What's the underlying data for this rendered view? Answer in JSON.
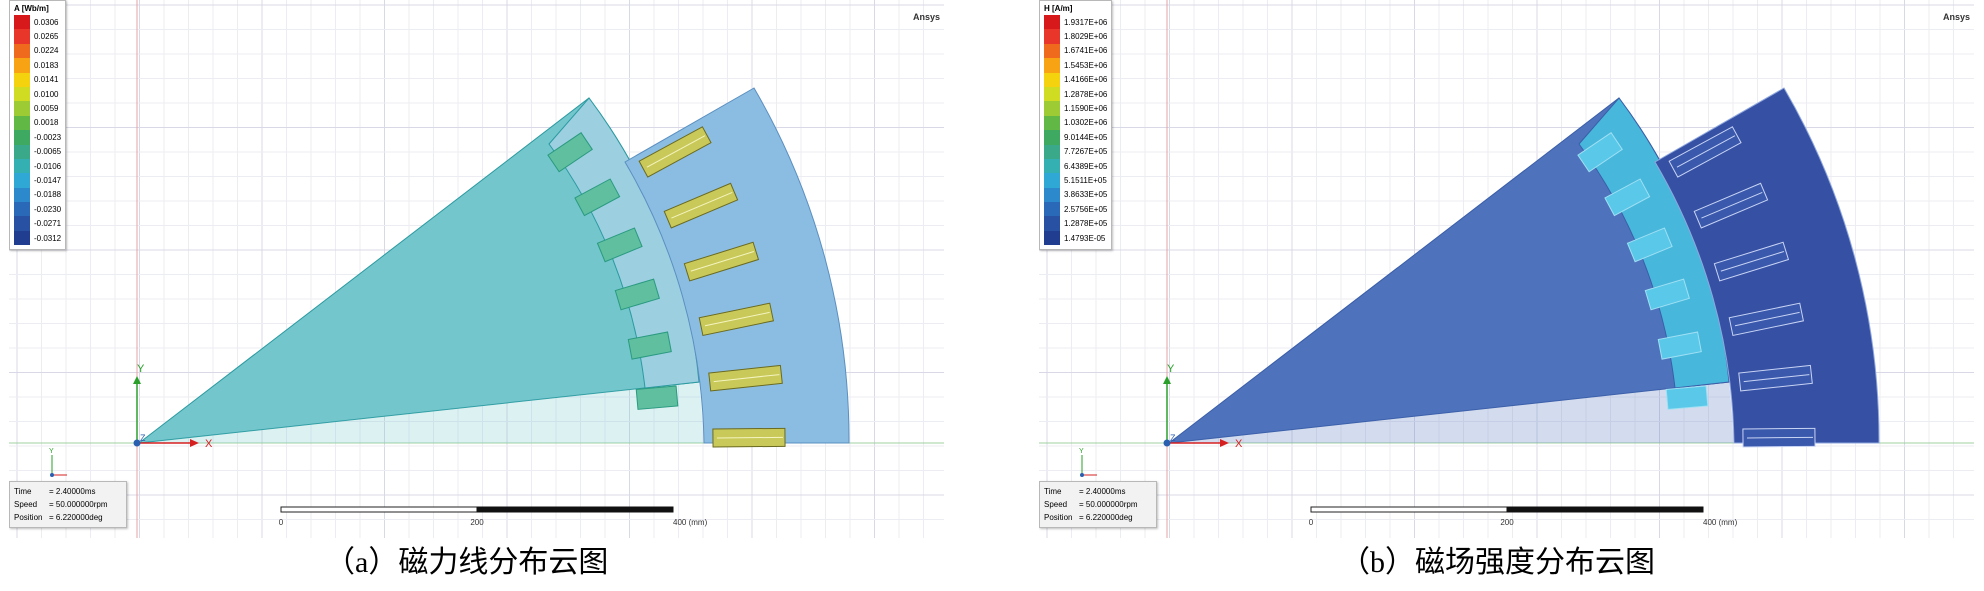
{
  "brand": "Ansys",
  "axes": {
    "y": "Y",
    "x": "X",
    "z": "Z"
  },
  "panels": [
    {
      "id": "a",
      "legend_title": "A [Wb/m]",
      "legend_values": [
        "0.0306",
        "0.0265",
        "0.0224",
        "0.0183",
        "0.0141",
        "0.0100",
        "0.0059",
        "0.0018",
        "-0.0023",
        "-0.0065",
        "-0.0106",
        "-0.0147",
        "-0.0188",
        "-0.0230",
        "-0.0271",
        "-0.0312"
      ],
      "caption": "（a）磁力线分布云图",
      "style": {
        "rotor": "#73c6cc",
        "rotor_edge": "#2a9aa0",
        "teeth": "#9ccfe0",
        "stator": "#8bbde3",
        "bars": "#c9c95a",
        "stator_edge": "#5a8fc0"
      }
    },
    {
      "id": "b",
      "legend_title": "H [A/m]",
      "legend_values": [
        "1.9317E+06",
        "1.8029E+06",
        "1.6741E+06",
        "1.5453E+06",
        "1.4166E+06",
        "1.2878E+06",
        "1.1590E+06",
        "1.0302E+06",
        "9.0144E+05",
        "7.7267E+05",
        "6.4389E+05",
        "5.1511E+05",
        "3.8633E+05",
        "2.5756E+05",
        "1.2878E+05",
        "1.4793E-05"
      ],
      "caption": "（b）磁场强度分布云图",
      "style": {
        "rotor": "#4f72bd",
        "rotor_edge": "#3a5ea8",
        "teeth": "#47b7dc",
        "stator": "#3650a4",
        "bars": "#3a58ac",
        "stator_edge": "#8fa7de"
      }
    }
  ],
  "legend_colors": [
    "#d7191c",
    "#e8362a",
    "#f06a1e",
    "#f7a314",
    "#f4d20e",
    "#cfdc22",
    "#9ccb34",
    "#62b845",
    "#3ea960",
    "#3aa98a",
    "#34b0b2",
    "#2fa8d6",
    "#2c89cc",
    "#2a68b8",
    "#2850a3",
    "#213d8f"
  ],
  "info": {
    "time_label": "Time",
    "time_value": "= 2.40000ms",
    "speed_label": "Speed",
    "speed_value": "= 50.000000rpm",
    "position_label": "Position",
    "position_value": "= 6.220000deg"
  },
  "scale_bar": {
    "labels": [
      "0",
      "200",
      "400 (mm)"
    ]
  }
}
